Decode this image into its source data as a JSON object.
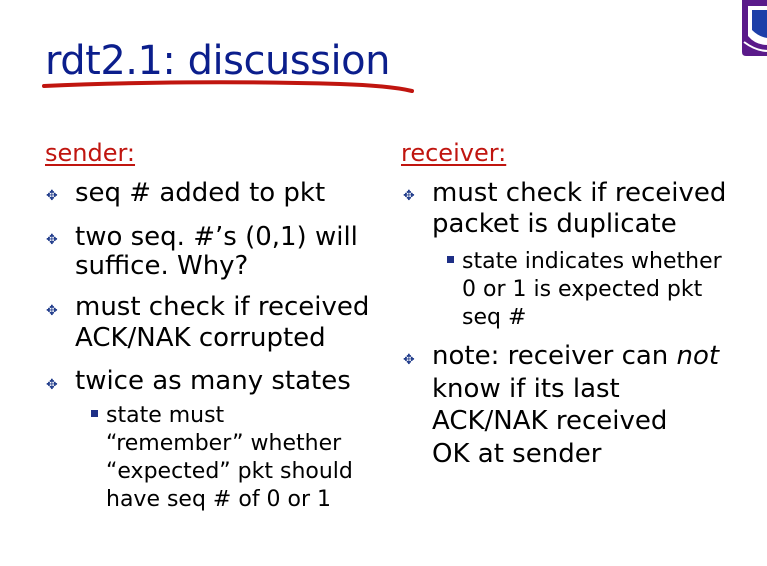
{
  "title": "rdt2.1: discussion",
  "colors": {
    "title": "#0b1e8c",
    "heading": "#c0150f",
    "swoosh": "#c0150f",
    "bullet_marker": "#1e3a8a"
  },
  "icons": {
    "bullet": "diamond-cluster-bullet",
    "sub_bullet": "square-bullet",
    "logo": "university-seal-logo"
  },
  "sender": {
    "heading": "sender:",
    "bullet1": "seq # added to pkt",
    "bullet2_line1": "two seq. #’s (0,1) will",
    "bullet2_line2": "suffice.  Why?",
    "bullet3_line1": "must check if received",
    "bullet3_line2": "ACK/NAK corrupted",
    "bullet4": "twice as many states",
    "sub1_line1": "state must",
    "sub1_line2": "“remember” whether",
    "sub1_line3": "“expected” pkt should",
    "sub1_line4": "have seq # of 0 or 1"
  },
  "receiver": {
    "heading": "receiver:",
    "bullet1_line1": "must check if received",
    "bullet1_line2": "packet is duplicate",
    "sub1_line1": "state indicates whether",
    "sub1_line2": "0 or 1 is expected pkt",
    "sub1_line3": "seq #",
    "bullet2_prefix": "note: receiver can ",
    "bullet2_emph": "not",
    "bullet2_line2": "know if its last",
    "bullet2_line3": "ACK/NAK received",
    "bullet2_line4": "OK at sender"
  }
}
